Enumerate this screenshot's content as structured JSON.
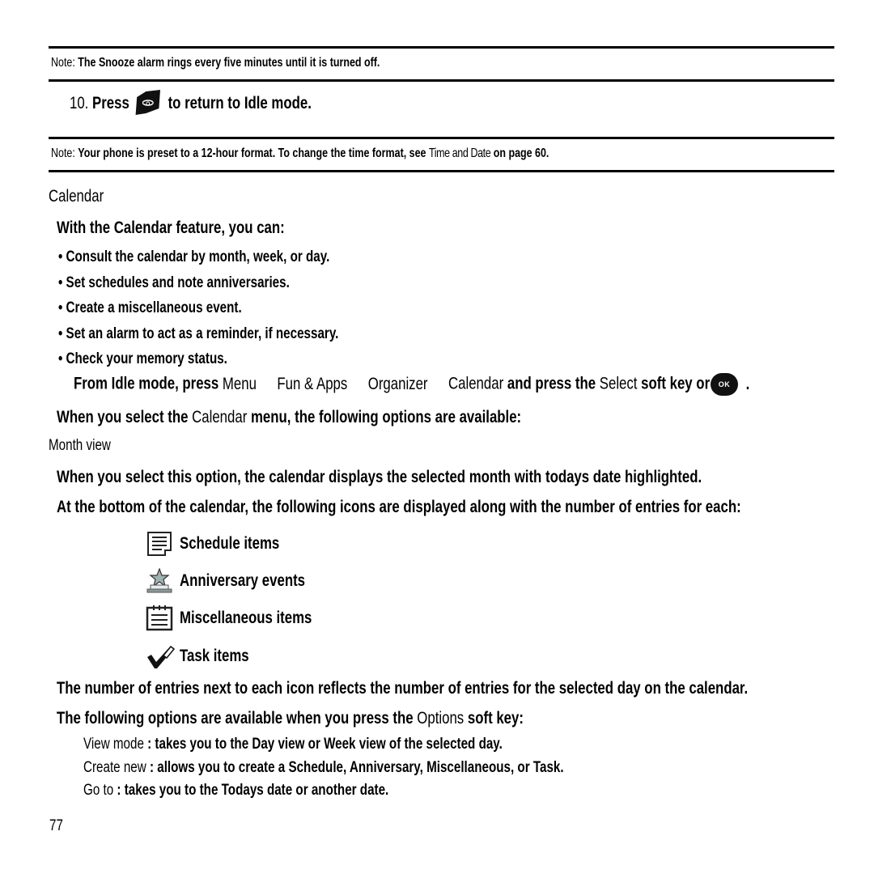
{
  "note1": {
    "label": "Note:",
    "text": "The Snooze alarm rings every five minutes until it is turned off."
  },
  "step10": {
    "number": "10.",
    "press": "Press",
    "icon": "end-key-icon",
    "rest": "to return to Idle mode."
  },
  "note2": {
    "label": "Note:",
    "text_before": "Your phone is preset to a 12-hour format. To change the time format, see",
    "link": "Time and Date",
    "text_after": "on page 60."
  },
  "section_title": "Calendar",
  "intro": "With the Calendar feature, you can:",
  "bullets": [
    "Consult the calendar by month, week, or day.",
    "Set schedules and note anniversaries.",
    "Create a miscellaneous event.",
    "Set an alarm to act as a reminder, if necessary.",
    "Check your memory status."
  ],
  "instruction": {
    "prefix": "From Idle mode, press",
    "path": [
      "Menu",
      "Fun & Apps",
      "Organizer",
      "Calendar"
    ],
    "middle": "and press the",
    "softkey": "Select",
    "suffix": "soft key or",
    "ok_label": "OK",
    "end": "."
  },
  "options_intro": {
    "prefix": "When you select the",
    "menu": "Calendar",
    "suffix": "menu, the following options are available:"
  },
  "subsection_title": "Month view",
  "month_view_p1": "When you select this option, the calendar displays the selected month with todays date highlighted.",
  "month_view_p2": "At the bottom of the calendar, the following icons are displayed along with the number of entries for each:",
  "icon_items": [
    {
      "icon": "schedule-icon",
      "label": "Schedule items"
    },
    {
      "icon": "anniversary-icon",
      "label": "Anniversary events"
    },
    {
      "icon": "miscellaneous-icon",
      "label": "Miscellaneous items"
    },
    {
      "icon": "task-icon",
      "label": "Task items"
    }
  ],
  "entries_note": "The number of entries next to each icon reflects the number of entries for the selected day on the calendar.",
  "options_softkey": {
    "prefix": "The following options are available when you press the",
    "softkey": "Options",
    "suffix": "soft key:"
  },
  "options": [
    {
      "name": "View mode",
      "desc": ": takes you to the Day view or Week view of the selected day."
    },
    {
      "name": "Create new",
      "desc": ": allows you to create a Schedule, Anniversary, Miscellaneous, or Task."
    },
    {
      "name": "Go to",
      "desc": ": takes you to the Todays date or another date."
    }
  ],
  "page_number": "77"
}
